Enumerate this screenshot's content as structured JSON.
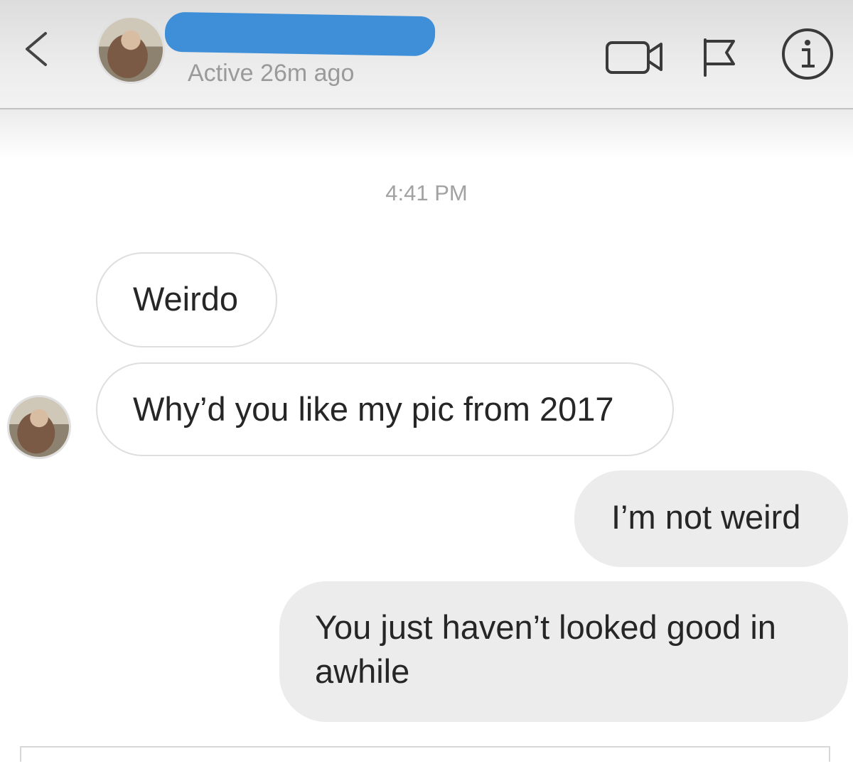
{
  "header": {
    "status": "Active 26m ago",
    "back_icon": "chevron-left-icon",
    "actions": [
      "video-call-icon",
      "flag-icon",
      "info-icon"
    ]
  },
  "thread": {
    "timestamp": "4:41 PM",
    "messages": [
      {
        "from": "them",
        "text": "Weirdo"
      },
      {
        "from": "them",
        "text": "Why’d you like my pic from 2017"
      },
      {
        "from": "me",
        "text": "I’m not weird"
      },
      {
        "from": "me",
        "text": "You just haven’t looked good in awhile"
      }
    ]
  },
  "colors": {
    "redaction": "#3f8fd8",
    "incoming_bubble": "#ffffff",
    "outgoing_bubble": "#ececec",
    "muted_text": "#9a9a9a"
  }
}
